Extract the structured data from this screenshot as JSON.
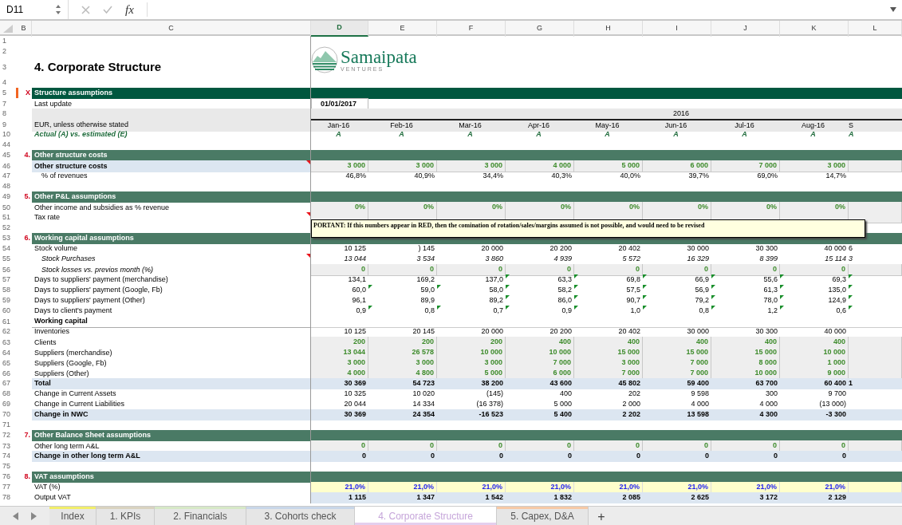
{
  "formula_bar": {
    "cell_ref": "D11",
    "fx_label": "fx"
  },
  "columns": [
    {
      "label": "B",
      "selected": false
    },
    {
      "label": "C",
      "selected": false
    },
    {
      "label": "D",
      "selected": true
    },
    {
      "label": "E",
      "selected": false
    },
    {
      "label": "F",
      "selected": false
    },
    {
      "label": "G",
      "selected": false
    },
    {
      "label": "H",
      "selected": false
    },
    {
      "label": "I",
      "selected": false
    },
    {
      "label": "J",
      "selected": false
    },
    {
      "label": "K",
      "selected": false
    },
    {
      "label": "L",
      "selected": false
    }
  ],
  "logo": {
    "name": "Samaipata",
    "tagline": "VENTURES"
  },
  "rows": [
    {
      "number": "1",
      "kind": "blank"
    },
    {
      "number": "2",
      "kind": "blank"
    },
    {
      "number": "3",
      "kind": "title",
      "label": "4. Corporate Structure"
    },
    {
      "number": "4",
      "kind": "blank"
    },
    {
      "number": "5",
      "kind": "section",
      "marker": "X",
      "label": "Structure assumptions",
      "color": "#00573f",
      "flagged": true
    },
    {
      "number": "7",
      "kind": "data",
      "label": {
        "kind": "plain",
        "text": "Last update"
      },
      "cells": {
        "kind": "date",
        "values": [
          "01/01/2017"
        ]
      }
    },
    {
      "number": "8",
      "kind": "data",
      "label": {
        "kind": "band"
      },
      "cells": {
        "kind": "year",
        "text": "2016"
      }
    },
    {
      "number": "9",
      "kind": "data",
      "label": {
        "kind": "band",
        "text": "EUR, unless otherwise stated"
      },
      "cells": {
        "kind": "month",
        "values": [
          "Jan-16",
          "Feb-16",
          "Mar-16",
          "Apr-16",
          "May-16",
          "Jun-16",
          "Jul-16",
          "Aug-16"
        ],
        "cut": "S"
      }
    },
    {
      "number": "10",
      "kind": "data",
      "label": {
        "kind": "actual",
        "text": "Actual (A) vs. estimated (E)"
      },
      "cells": {
        "kind": "actual",
        "values": [
          "A",
          "A",
          "A",
          "A",
          "A",
          "A",
          "A",
          "A"
        ],
        "cut": "A"
      }
    },
    {
      "number": "44",
      "kind": "blank"
    },
    {
      "number": "45",
      "kind": "section",
      "marker": "4.",
      "label": "Other structure costs",
      "color": "#4a7a65",
      "flagged": false
    },
    {
      "number": "46",
      "kind": "data",
      "label": {
        "kind": "total",
        "text": "Other structure costs"
      },
      "comment": true,
      "cells": {
        "kind": "input",
        "values": [
          "3 000",
          "3 000",
          "3 000",
          "4 000",
          "5 000",
          "6 000",
          "7 000",
          "3 000"
        ]
      }
    },
    {
      "number": "47",
      "kind": "data",
      "label": {
        "kind": "indent",
        "text": "% of revenues"
      },
      "cells": {
        "kind": "plain",
        "values": [
          "46,8%",
          "40,9%",
          "34,4%",
          "40,3%",
          "40,0%",
          "39,7%",
          "69,0%",
          "14,7%"
        ]
      }
    },
    {
      "number": "48",
      "kind": "blank"
    },
    {
      "number": "49",
      "kind": "section",
      "marker": "5.",
      "label": "Other P&L assumptions",
      "color": "#4a7a65",
      "flagged": false
    },
    {
      "number": "50",
      "kind": "data",
      "label": {
        "kind": "plain",
        "text": "Other income and subsidies as % revenue"
      },
      "cells": {
        "kind": "input",
        "values": [
          "0%",
          "0%",
          "0%",
          "0%",
          "0%",
          "0%",
          "0%",
          "0%"
        ]
      }
    },
    {
      "number": "51",
      "kind": "data",
      "label": {
        "kind": "plain",
        "text": "Tax rate"
      },
      "comment": true,
      "cells": {
        "kind": "input"
      },
      "note": "PORTANT: If this numbers appear in RED, then the comination of rotation/sales/margins assumed is not possible, and would need to be revised"
    },
    {
      "number": "52",
      "kind": "blank"
    },
    {
      "number": "53",
      "kind": "section",
      "marker": "6.",
      "label": "Working capital assumptions",
      "color": "#4a7a65",
      "flagged": false
    },
    {
      "number": "54",
      "kind": "data",
      "label": {
        "kind": "plain",
        "text": "Stock volume"
      },
      "cells": {
        "kind": "plain",
        "values": [
          "10 125",
          ") 145",
          "20 000",
          "20 200",
          "20 402",
          "30 000",
          "30 300",
          "40 000"
        ],
        "cut": "6"
      }
    },
    {
      "number": "55",
      "kind": "data",
      "label": {
        "kind": "sub",
        "text": "Stock Purchases"
      },
      "comment": true,
      "cells": {
        "kind": "italic",
        "values": [
          "13 044",
          "3 534",
          "3 860",
          "4 939",
          "5 572",
          "16 329",
          "8 399",
          "15 114"
        ],
        "cut": "3"
      }
    },
    {
      "number": "56",
      "kind": "data",
      "label": {
        "kind": "sub",
        "text": "Stock losses vs. previos month (%)"
      },
      "cells": {
        "kind": "input",
        "values": [
          "0",
          "0",
          "0",
          "0",
          "0",
          "0",
          "0",
          "0"
        ]
      }
    },
    {
      "number": "57",
      "kind": "data",
      "label": {
        "kind": "plain",
        "text": "Days to suppliers' payment (merchandise)"
      },
      "cells": {
        "kind": "plain",
        "values": [
          "134,1",
          "169,2",
          "137,0",
          "63,3",
          "69,8",
          "66,9",
          "55,6",
          "69,3"
        ]
      },
      "flags": [
        false,
        false,
        true,
        true,
        true,
        true,
        true,
        true
      ]
    },
    {
      "number": "58",
      "kind": "data",
      "label": {
        "kind": "plain",
        "text": "Days to suppliers' payment (Google, Fb)"
      },
      "cells": {
        "kind": "plain",
        "values": [
          "60,0",
          "59,0",
          "58,0",
          "58,2",
          "57,5",
          "56,9",
          "61,3",
          "135,0"
        ]
      },
      "flags": [
        true,
        true,
        true,
        true,
        true,
        true,
        true,
        true
      ]
    },
    {
      "number": "59",
      "kind": "data",
      "label": {
        "kind": "plain",
        "text": "Days to suppliers' payment (Other)"
      },
      "cells": {
        "kind": "plain",
        "values": [
          "96,1",
          "89,9",
          "89,2",
          "86,0",
          "90,7",
          "79,2",
          "78,0",
          "124,9"
        ]
      },
      "flags": [
        false,
        false,
        true,
        true,
        true,
        true,
        true,
        true
      ]
    },
    {
      "number": "60",
      "kind": "data",
      "label": {
        "kind": "plain",
        "text": "Days to client's payment"
      },
      "cells": {
        "kind": "plain",
        "values": [
          "0,9",
          "0,8",
          "0,7",
          "0,9",
          "1,0",
          "0,8",
          "1,2",
          "0,6"
        ]
      },
      "flags": [
        true,
        true,
        true,
        true,
        true,
        true,
        true,
        true
      ]
    },
    {
      "number": "61",
      "kind": "data",
      "label": {
        "kind": "heading",
        "text": "Working capital"
      },
      "cells": {
        "kind": "heading"
      }
    },
    {
      "number": "62",
      "kind": "data",
      "label": {
        "kind": "plain",
        "text": "Inventories"
      },
      "cells": {
        "kind": "plain",
        "values": [
          "10 125",
          "20 145",
          "20 000",
          "20 200",
          "20 402",
          "30 000",
          "30 300",
          "40 000"
        ]
      }
    },
    {
      "number": "63",
      "kind": "data",
      "label": {
        "kind": "plain",
        "text": "Clients"
      },
      "cells": {
        "kind": "input",
        "values": [
          "200",
          "200",
          "200",
          "400",
          "400",
          "400",
          "400",
          "400"
        ]
      }
    },
    {
      "number": "64",
      "kind": "data",
      "label": {
        "kind": "plain",
        "text": "Suppliers (merchandise)"
      },
      "cells": {
        "kind": "input",
        "values": [
          "13 044",
          "26 578",
          "10 000",
          "10 000",
          "15 000",
          "15 000",
          "15 000",
          "10 000"
        ]
      }
    },
    {
      "number": "65",
      "kind": "data",
      "label": {
        "kind": "plain",
        "text": "Suppliers (Google, Fb)"
      },
      "cells": {
        "kind": "input",
        "values": [
          "3 000",
          "3 000",
          "3 000",
          "7 000",
          "3 000",
          "7 000",
          "8 000",
          "1 000"
        ]
      }
    },
    {
      "number": "66",
      "kind": "data",
      "label": {
        "kind": "plain",
        "text": "Suppliers (Other)"
      },
      "cells": {
        "kind": "input",
        "values": [
          "4 000",
          "4 800",
          "5 000",
          "6 000",
          "7 000",
          "7 000",
          "10 000",
          "9 000"
        ]
      }
    },
    {
      "number": "67",
      "kind": "data",
      "label": {
        "kind": "total",
        "text": "Total"
      },
      "cells": {
        "kind": "total",
        "values": [
          "30 369",
          "54 723",
          "38 200",
          "43 600",
          "45 802",
          "59 400",
          "63 700",
          "60 400"
        ],
        "cut": "1"
      }
    },
    {
      "number": "68",
      "kind": "data",
      "label": {
        "kind": "plain",
        "text": "Change in Current Assets"
      },
      "cells": {
        "kind": "plain",
        "values": [
          "10 325",
          "10 020",
          "(145)",
          "400",
          "202",
          "9 598",
          "300",
          "9 700"
        ]
      }
    },
    {
      "number": "69",
      "kind": "data",
      "label": {
        "kind": "plain",
        "text": "Change in Current Liabilities"
      },
      "cells": {
        "kind": "plain",
        "values": [
          "20 044",
          "14 334",
          "(16 378)",
          "5 000",
          "2 000",
          "4 000",
          "4 000",
          "(13 000)"
        ]
      }
    },
    {
      "number": "70",
      "kind": "data",
      "label": {
        "kind": "total",
        "text": "Change in NWC"
      },
      "cells": {
        "kind": "total",
        "values": [
          "30 369",
          "24 354",
          "-16 523",
          "5 400",
          "2 202",
          "13 598",
          "4 300",
          "-3 300"
        ]
      }
    },
    {
      "number": "71",
      "kind": "blank"
    },
    {
      "number": "72",
      "kind": "section",
      "marker": "7.",
      "label": "Other Balance Sheet assumptions",
      "color": "#4a7a65",
      "flagged": false
    },
    {
      "number": "73",
      "kind": "data",
      "label": {
        "kind": "plain",
        "text": "Other long term A&L"
      },
      "cells": {
        "kind": "input",
        "values": [
          "0",
          "0",
          "0",
          "0",
          "0",
          "0",
          "0",
          "0"
        ]
      }
    },
    {
      "number": "74",
      "kind": "data",
      "label": {
        "kind": "total",
        "text": "Change in other long term A&L"
      },
      "cells": {
        "kind": "total",
        "values": [
          "0",
          "0",
          "0",
          "0",
          "0",
          "0",
          "0",
          "0"
        ]
      }
    },
    {
      "number": "75",
      "kind": "blank"
    },
    {
      "number": "76",
      "kind": "section",
      "marker": "8.",
      "label": "VAT assumptions",
      "color": "#4a7a65",
      "flagged": false
    },
    {
      "number": "77",
      "kind": "data",
      "label": {
        "kind": "plain",
        "text": "VAT (%)"
      },
      "cells": {
        "kind": "vat",
        "values": [
          "21,0%",
          "21,0%",
          "21,0%",
          "21,0%",
          "21,0%",
          "21,0%",
          "21,0%",
          "21,0%"
        ]
      }
    },
    {
      "number": "78",
      "kind": "data",
      "label": {
        "kind": "plain",
        "text": "Output VAT"
      },
      "cells": {
        "kind": "total",
        "values": [
          "1 115",
          "1 347",
          "1 542",
          "1 832",
          "2 085",
          "2 625",
          "3 172",
          "2 129"
        ]
      }
    }
  ],
  "tabs": [
    {
      "label": "Index",
      "selected": false,
      "color": "#f2ee6a"
    },
    {
      "label": "1. KPIs",
      "selected": false,
      "color": "#d9d3c0"
    },
    {
      "label": "2. Financials",
      "selected": false,
      "color": "#d6e8c6"
    },
    {
      "label": "3. Cohorts check",
      "selected": false,
      "color": "#c8d6e8"
    },
    {
      "label": "4. Corporate Structure",
      "selected": true,
      "color": "#e4cfee"
    },
    {
      "label": "5. Capex, D&A",
      "selected": false,
      "color": "#f6c9a6"
    }
  ],
  "add_tab": "+"
}
